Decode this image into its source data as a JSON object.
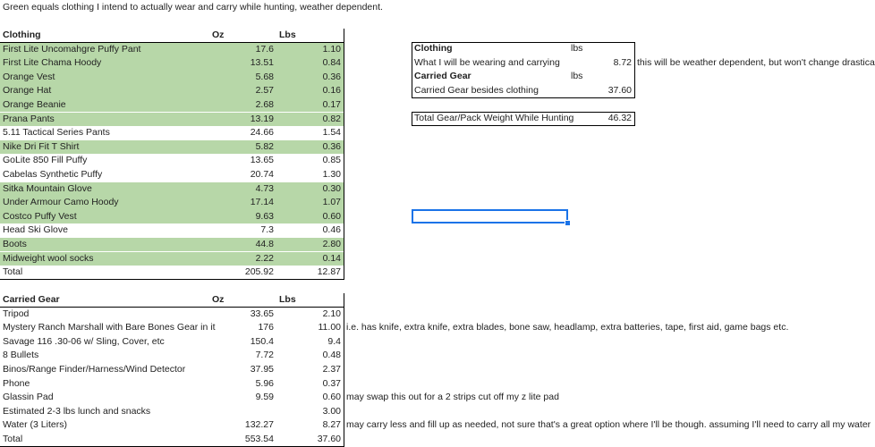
{
  "note": "Green equals clothing I intend to actually wear and carry while hunting, weather dependent.",
  "clothing": {
    "header": {
      "name": "Clothing",
      "oz": "Oz",
      "lbs": "Lbs"
    },
    "rows": [
      {
        "name": "First Lite Uncomahgre Puffy Pant",
        "oz": "17.6",
        "lbs": "1.10",
        "green": true
      },
      {
        "name": "First Lite Chama Hoody",
        "oz": "13.51",
        "lbs": "0.84",
        "green": true
      },
      {
        "name": "Orange Vest",
        "oz": "5.68",
        "lbs": "0.36",
        "green": true
      },
      {
        "name": "Orange Hat",
        "oz": "2.57",
        "lbs": "0.16",
        "green": true
      },
      {
        "name": "Orange Beanie",
        "oz": "2.68",
        "lbs": "0.17",
        "green": true
      },
      {
        "name": "Prana Pants",
        "oz": "13.19",
        "lbs": "0.82",
        "green": true
      },
      {
        "name": "5.11 Tactical Series Pants",
        "oz": "24.66",
        "lbs": "1.54",
        "green": false
      },
      {
        "name": "Nike Dri Fit T Shirt",
        "oz": "5.82",
        "lbs": "0.36",
        "green": true
      },
      {
        "name": "GoLite 850 Fill Puffy",
        "oz": "13.65",
        "lbs": "0.85",
        "green": false
      },
      {
        "name": "Cabelas Synthetic Puffy",
        "oz": "20.74",
        "lbs": "1.30",
        "green": false
      },
      {
        "name": "Sitka Mountain Glove",
        "oz": "4.73",
        "lbs": "0.30",
        "green": true
      },
      {
        "name": "Under Armour Camo Hoody",
        "oz": "17.14",
        "lbs": "1.07",
        "green": true
      },
      {
        "name": "Costco Puffy Vest",
        "oz": "9.63",
        "lbs": "0.60",
        "green": true
      },
      {
        "name": "Head Ski Glove",
        "oz": "7.3",
        "lbs": "0.46",
        "green": false
      },
      {
        "name": "Boots",
        "oz": "44.8",
        "lbs": "2.80",
        "green": true
      },
      {
        "name": "Midweight wool socks",
        "oz": "2.22",
        "lbs": "0.14",
        "green": true
      }
    ],
    "total": {
      "name": "Total",
      "oz": "205.92",
      "lbs": "12.87"
    }
  },
  "carried": {
    "header": {
      "name": "Carried Gear",
      "oz": "Oz",
      "lbs": "Lbs"
    },
    "rows": [
      {
        "name": "Tripod",
        "oz": "33.65",
        "lbs": "2.10",
        "note": ""
      },
      {
        "name": "Mystery Ranch Marshall with Bare Bones Gear in it",
        "oz": "176",
        "lbs": "11.00",
        "note": "i.e. has knife, extra knife, extra blades, bone saw, headlamp, extra batteries, tape, first aid, game bags etc."
      },
      {
        "name": "Savage 116 .30-06 w/ Sling, Cover, etc",
        "oz": "150.4",
        "lbs": "9.4",
        "note": ""
      },
      {
        "name": "8 Bullets",
        "oz": "7.72",
        "lbs": "0.48",
        "note": ""
      },
      {
        "name": "Binos/Range Finder/Harness/Wind Detector",
        "oz": "37.95",
        "lbs": "2.37",
        "note": ""
      },
      {
        "name": "Phone",
        "oz": "5.96",
        "lbs": "0.37",
        "note": ""
      },
      {
        "name": "Glassin Pad",
        "oz": "9.59",
        "lbs": "0.60",
        "note": "may swap this out for a 2 strips cut off my z lite pad"
      },
      {
        "name": "Estimated 2-3 lbs lunch and snacks",
        "oz": "",
        "lbs": "3.00",
        "note": ""
      },
      {
        "name": "Water (3 Liters)",
        "oz": "132.27",
        "lbs": "8.27",
        "note": "may carry less and fill up as needed, not sure that's a great option where I'll be though. assuming I'll need to carry all my water"
      }
    ],
    "total": {
      "name": "Total",
      "oz": "553.54",
      "lbs": "37.60"
    }
  },
  "summary": {
    "clothing_label": "Clothing",
    "clothing_unit": "lbs",
    "wearing_label": "What I will be wearing and carrying",
    "wearing_value": "8.72",
    "wearing_note": "this will be weather dependent, but won't change drastically",
    "carried_label": "Carried Gear",
    "carried_unit": "lbs",
    "carried_besides_label": "Carried Gear besides clothing",
    "carried_besides_value": "37.60",
    "total_label": "Total Gear/Pack Weight While Hunting",
    "total_value": "46.32"
  },
  "colors": {
    "green": "#b7d7a8",
    "selection": "#1a73e8"
  }
}
